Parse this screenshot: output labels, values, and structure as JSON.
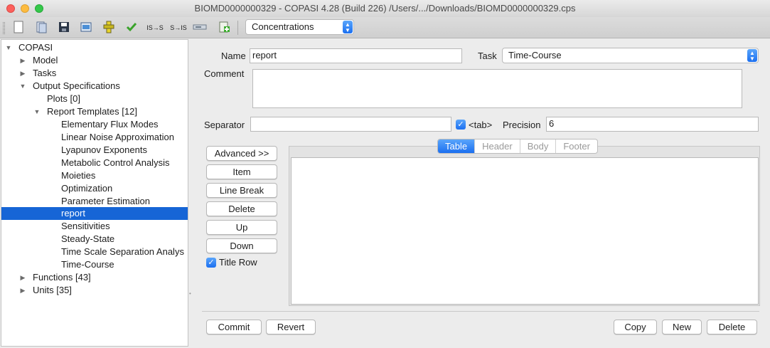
{
  "window": {
    "title": "BIOMD0000000329 - COPASI 4.28 (Build 226) /Users/.../Downloads/BIOMD0000000329.cps"
  },
  "toolbar": {
    "icons": [
      "new-file-icon",
      "open-file-icon",
      "save-icon",
      "export-image-icon",
      "model-icon",
      "check-icon",
      "is-to-s-icon",
      "s-to-is-icon",
      "slider-icon",
      "add-plugin-icon"
    ],
    "icon_labels": {
      "is_s": "IS→S",
      "s_is": "S→IS"
    },
    "concentration_mode": "Concentrations"
  },
  "tree": {
    "items": [
      {
        "label": "COPASI",
        "level": 0,
        "expanded": true
      },
      {
        "label": "Model",
        "level": 1,
        "expanded": false
      },
      {
        "label": "Tasks",
        "level": 1,
        "expanded": false
      },
      {
        "label": "Output Specifications",
        "level": 1,
        "expanded": true
      },
      {
        "label": "Plots [0]",
        "level": 2
      },
      {
        "label": "Report Templates [12]",
        "level": 2,
        "expanded": true
      },
      {
        "label": "Elementary Flux Modes",
        "level": 3
      },
      {
        "label": "Linear Noise Approximation",
        "level": 3
      },
      {
        "label": "Lyapunov Exponents",
        "level": 3
      },
      {
        "label": "Metabolic Control Analysis",
        "level": 3
      },
      {
        "label": "Moieties",
        "level": 3
      },
      {
        "label": "Optimization",
        "level": 3
      },
      {
        "label": "Parameter Estimation",
        "level": 3
      },
      {
        "label": "report",
        "level": 3,
        "selected": true
      },
      {
        "label": "Sensitivities",
        "level": 3
      },
      {
        "label": "Steady-State",
        "level": 3
      },
      {
        "label": "Time Scale Separation Analys",
        "level": 3
      },
      {
        "label": "Time-Course",
        "level": 3
      },
      {
        "label": "Functions [43]",
        "level": 1,
        "expanded": false
      },
      {
        "label": "Units [35]",
        "level": 1,
        "expanded": false
      }
    ]
  },
  "form": {
    "name_label": "Name",
    "name_value": "report",
    "task_label": "Task",
    "task_value": "Time-Course",
    "comment_label": "Comment",
    "comment_value": "",
    "separator_label": "Separator",
    "separator_value": "",
    "tab_check_label": "<tab>",
    "tab_checked": true,
    "precision_label": "Precision",
    "precision_value": "6",
    "title_row_label": "Title Row",
    "title_row_checked": true
  },
  "side_buttons": {
    "advanced": "Advanced >>",
    "item": "Item",
    "line_break": "Line Break",
    "delete": "Delete",
    "up": "Up",
    "down": "Down"
  },
  "tabs": [
    "Table",
    "Header",
    "Body",
    "Footer"
  ],
  "active_tab": "Table",
  "bottom_buttons": {
    "commit": "Commit",
    "revert": "Revert",
    "copy": "Copy",
    "new": "New",
    "delete": "Delete"
  },
  "colors": {
    "accent": "#1b6ff0",
    "selection": "#1665d6"
  }
}
